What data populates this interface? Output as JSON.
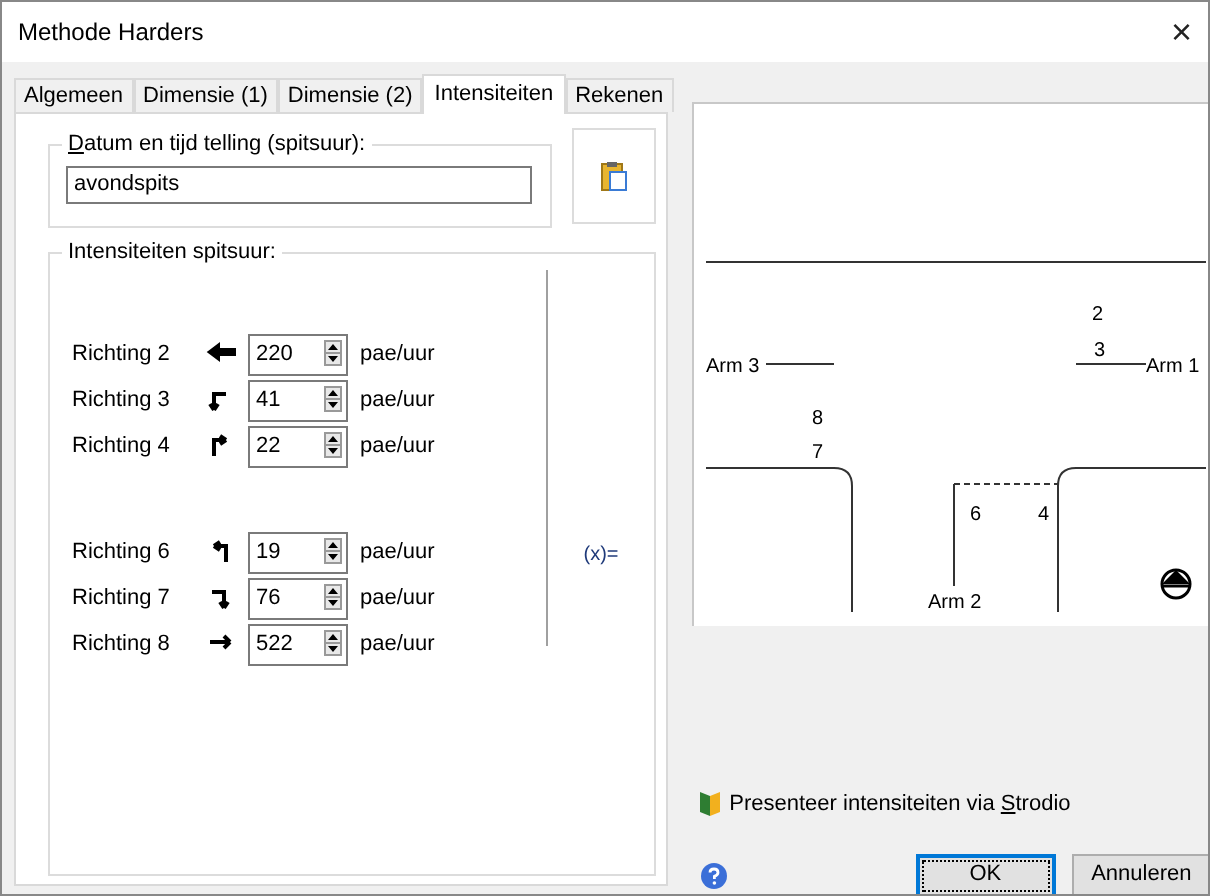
{
  "window": {
    "title": "Methode Harders",
    "close": "×"
  },
  "tabs": [
    {
      "label": "Algemeen",
      "selected": false
    },
    {
      "label": "Dimensie (1)",
      "selected": false
    },
    {
      "label": "Dimensie (2)",
      "selected": false
    },
    {
      "label": "Intensiteiten",
      "selected": true
    },
    {
      "label": "Rekenen",
      "selected": false
    }
  ],
  "date_group": {
    "label_underlined": "D",
    "label_rest": "atum en tijd telling (spitsuur):",
    "value": "avondspits"
  },
  "intensity_group": {
    "label": "Intensiteiten spitsuur:",
    "formula": "(x)=",
    "groups": [
      {
        "rows": [
          {
            "label": "Richting 2",
            "value": "220",
            "unit": "pae/uur"
          },
          {
            "label": "Richting 3",
            "value": "41",
            "unit": "pae/uur"
          },
          {
            "label": "Richting 4",
            "value": "22",
            "unit": "pae/uur"
          }
        ]
      },
      {
        "rows": [
          {
            "label": "Richting 6",
            "value": "19",
            "unit": "pae/uur"
          },
          {
            "label": "Richting 7",
            "value": "76",
            "unit": "pae/uur"
          },
          {
            "label": "Richting 8",
            "value": "522",
            "unit": "pae/uur"
          }
        ]
      }
    ]
  },
  "diagram": {
    "arm_labels": [
      "Arm 3",
      "Arm 1",
      "Arm 2"
    ],
    "direction_labels": [
      "2",
      "3",
      "8",
      "7",
      "6",
      "4"
    ]
  },
  "strodio_link": {
    "before": "Presenteer intensiteiten via ",
    "underlined": "S",
    "after": "trodio"
  },
  "buttons": [
    {
      "label": "OK",
      "selected": true
    },
    {
      "label": "Annuleren",
      "selected": false
    }
  ]
}
